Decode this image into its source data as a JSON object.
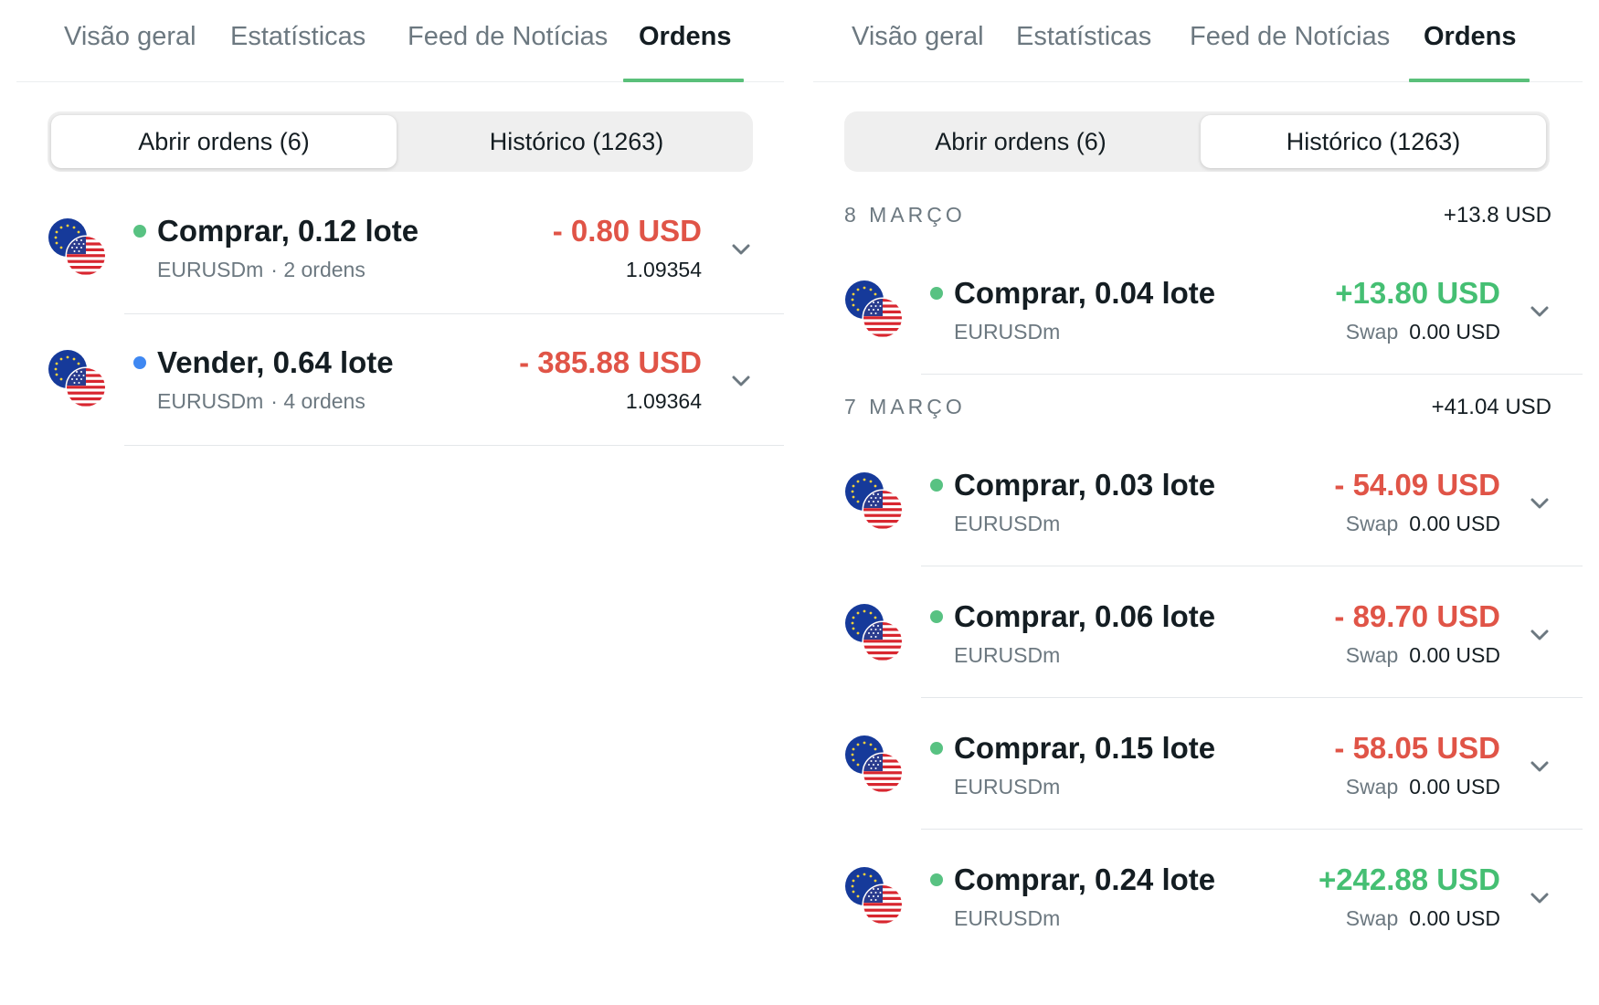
{
  "colors": {
    "accent_green": "#5ac07a",
    "loss_red": "#e05447",
    "profit_green": "#45bf73",
    "buy_dot": "#58c282",
    "sell_dot": "#3f88f2",
    "muted_text": "#6c7880"
  },
  "left": {
    "tabs": [
      "Visão geral",
      "Estatísticas",
      "Feed de Notícias",
      "Ordens"
    ],
    "active_tab": "Ordens",
    "segment": {
      "open": "Abrir ordens (6)",
      "history": "Histórico (1263)",
      "selected": "open"
    },
    "orders": [
      {
        "title": "Comprar, 0.12 lote",
        "symbol": "EURUSDm",
        "orders": "· 2 ordens",
        "amount": "- 0.80 USD",
        "price": "1.09354",
        "side": "buy",
        "icon": "eur-usd-flag-icon"
      },
      {
        "title": "Vender, 0.64 lote",
        "symbol": "EURUSDm",
        "orders": "· 4 ordens",
        "amount": "- 385.88 USD",
        "price": "1.09364",
        "side": "sell",
        "icon": "eur-usd-flag-icon"
      }
    ]
  },
  "right": {
    "tabs": [
      "Visão geral",
      "Estatísticas",
      "Feed de Notícias",
      "Ordens"
    ],
    "active_tab": "Ordens",
    "segment": {
      "open": "Abrir ordens (6)",
      "history": "Histórico (1263)",
      "selected": "history"
    },
    "groups": [
      {
        "date": "8 MARÇO",
        "total": "+13.8 USD",
        "items": [
          {
            "title": "Comprar, 0.04 lote",
            "symbol": "EURUSDm",
            "amount": "+13.80 USD",
            "swap_label": "Swap",
            "swap": "0.00 USD",
            "sign": "pos",
            "icon": "eur-usd-flag-icon"
          }
        ]
      },
      {
        "date": "7 MARÇO",
        "total": "+41.04 USD",
        "items": [
          {
            "title": "Comprar, 0.03 lote",
            "symbol": "EURUSDm",
            "amount": "- 54.09 USD",
            "swap_label": "Swap",
            "swap": "0.00 USD",
            "sign": "neg",
            "icon": "eur-usd-flag-icon"
          },
          {
            "title": "Comprar, 0.06 lote",
            "symbol": "EURUSDm",
            "amount": "- 89.70 USD",
            "swap_label": "Swap",
            "swap": "0.00 USD",
            "sign": "neg",
            "icon": "eur-usd-flag-icon"
          },
          {
            "title": "Comprar, 0.15 lote",
            "symbol": "EURUSDm",
            "amount": "- 58.05 USD",
            "swap_label": "Swap",
            "swap": "0.00 USD",
            "sign": "neg",
            "icon": "eur-usd-flag-icon"
          },
          {
            "title": "Comprar, 0.24 lote",
            "symbol": "EURUSDm",
            "amount": "+242.88 USD",
            "swap_label": "Swap",
            "swap": "0.00 USD",
            "sign": "pos",
            "icon": "eur-usd-flag-icon"
          }
        ]
      }
    ]
  }
}
